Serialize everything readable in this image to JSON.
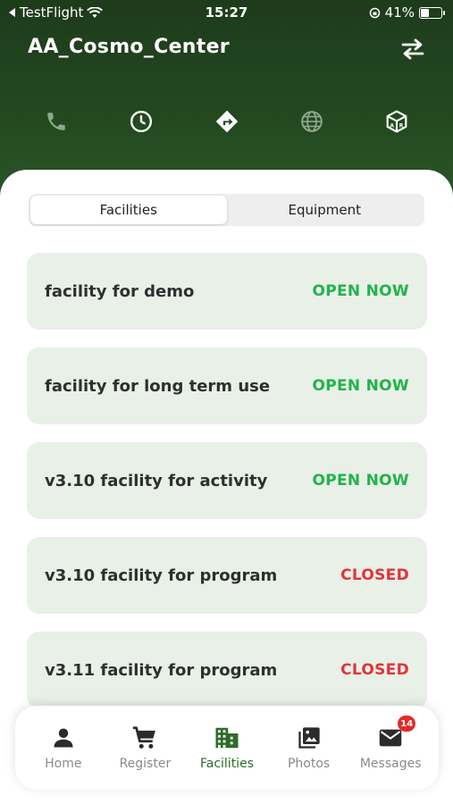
{
  "status_bar": {
    "back_label": "TestFlight",
    "time": "15:27",
    "battery_text": "41%",
    "battery_level": 0.41
  },
  "header": {
    "title": "AA_Cosmo_Center",
    "actions": [
      {
        "icon": "phone-icon"
      },
      {
        "icon": "clock-icon"
      },
      {
        "icon": "directions-icon"
      },
      {
        "icon": "globe-icon"
      },
      {
        "icon": "ar-cube-icon"
      }
    ]
  },
  "tabs": [
    {
      "label": "Facilities",
      "active": true
    },
    {
      "label": "Equipment",
      "active": false
    }
  ],
  "facilities": [
    {
      "name": "facility for demo",
      "status": "OPEN NOW",
      "open": true
    },
    {
      "name": "facility for long term use",
      "status": "OPEN NOW",
      "open": true
    },
    {
      "name": "v3.10 facility for activity",
      "status": "OPEN NOW",
      "open": true
    },
    {
      "name": "v3.10 facility for program",
      "status": "CLOSED",
      "open": false
    },
    {
      "name": "v3.11 facility for program",
      "status": "CLOSED",
      "open": false
    }
  ],
  "bottom_nav": [
    {
      "label": "Home",
      "icon": "person-icon",
      "active": false
    },
    {
      "label": "Register",
      "icon": "cart-icon",
      "active": false
    },
    {
      "label": "Facilities",
      "icon": "building-icon",
      "active": true
    },
    {
      "label": "Photos",
      "icon": "photos-icon",
      "active": false
    },
    {
      "label": "Messages",
      "icon": "mail-icon",
      "active": false,
      "badge": "14"
    }
  ],
  "colors": {
    "header_green": "#244a21",
    "open": "#22b34a",
    "closed": "#e0343a",
    "active_nav": "#2e6b2b",
    "inactive_nav": "#8a8a8a",
    "card_bg": "#e8f0e8"
  }
}
